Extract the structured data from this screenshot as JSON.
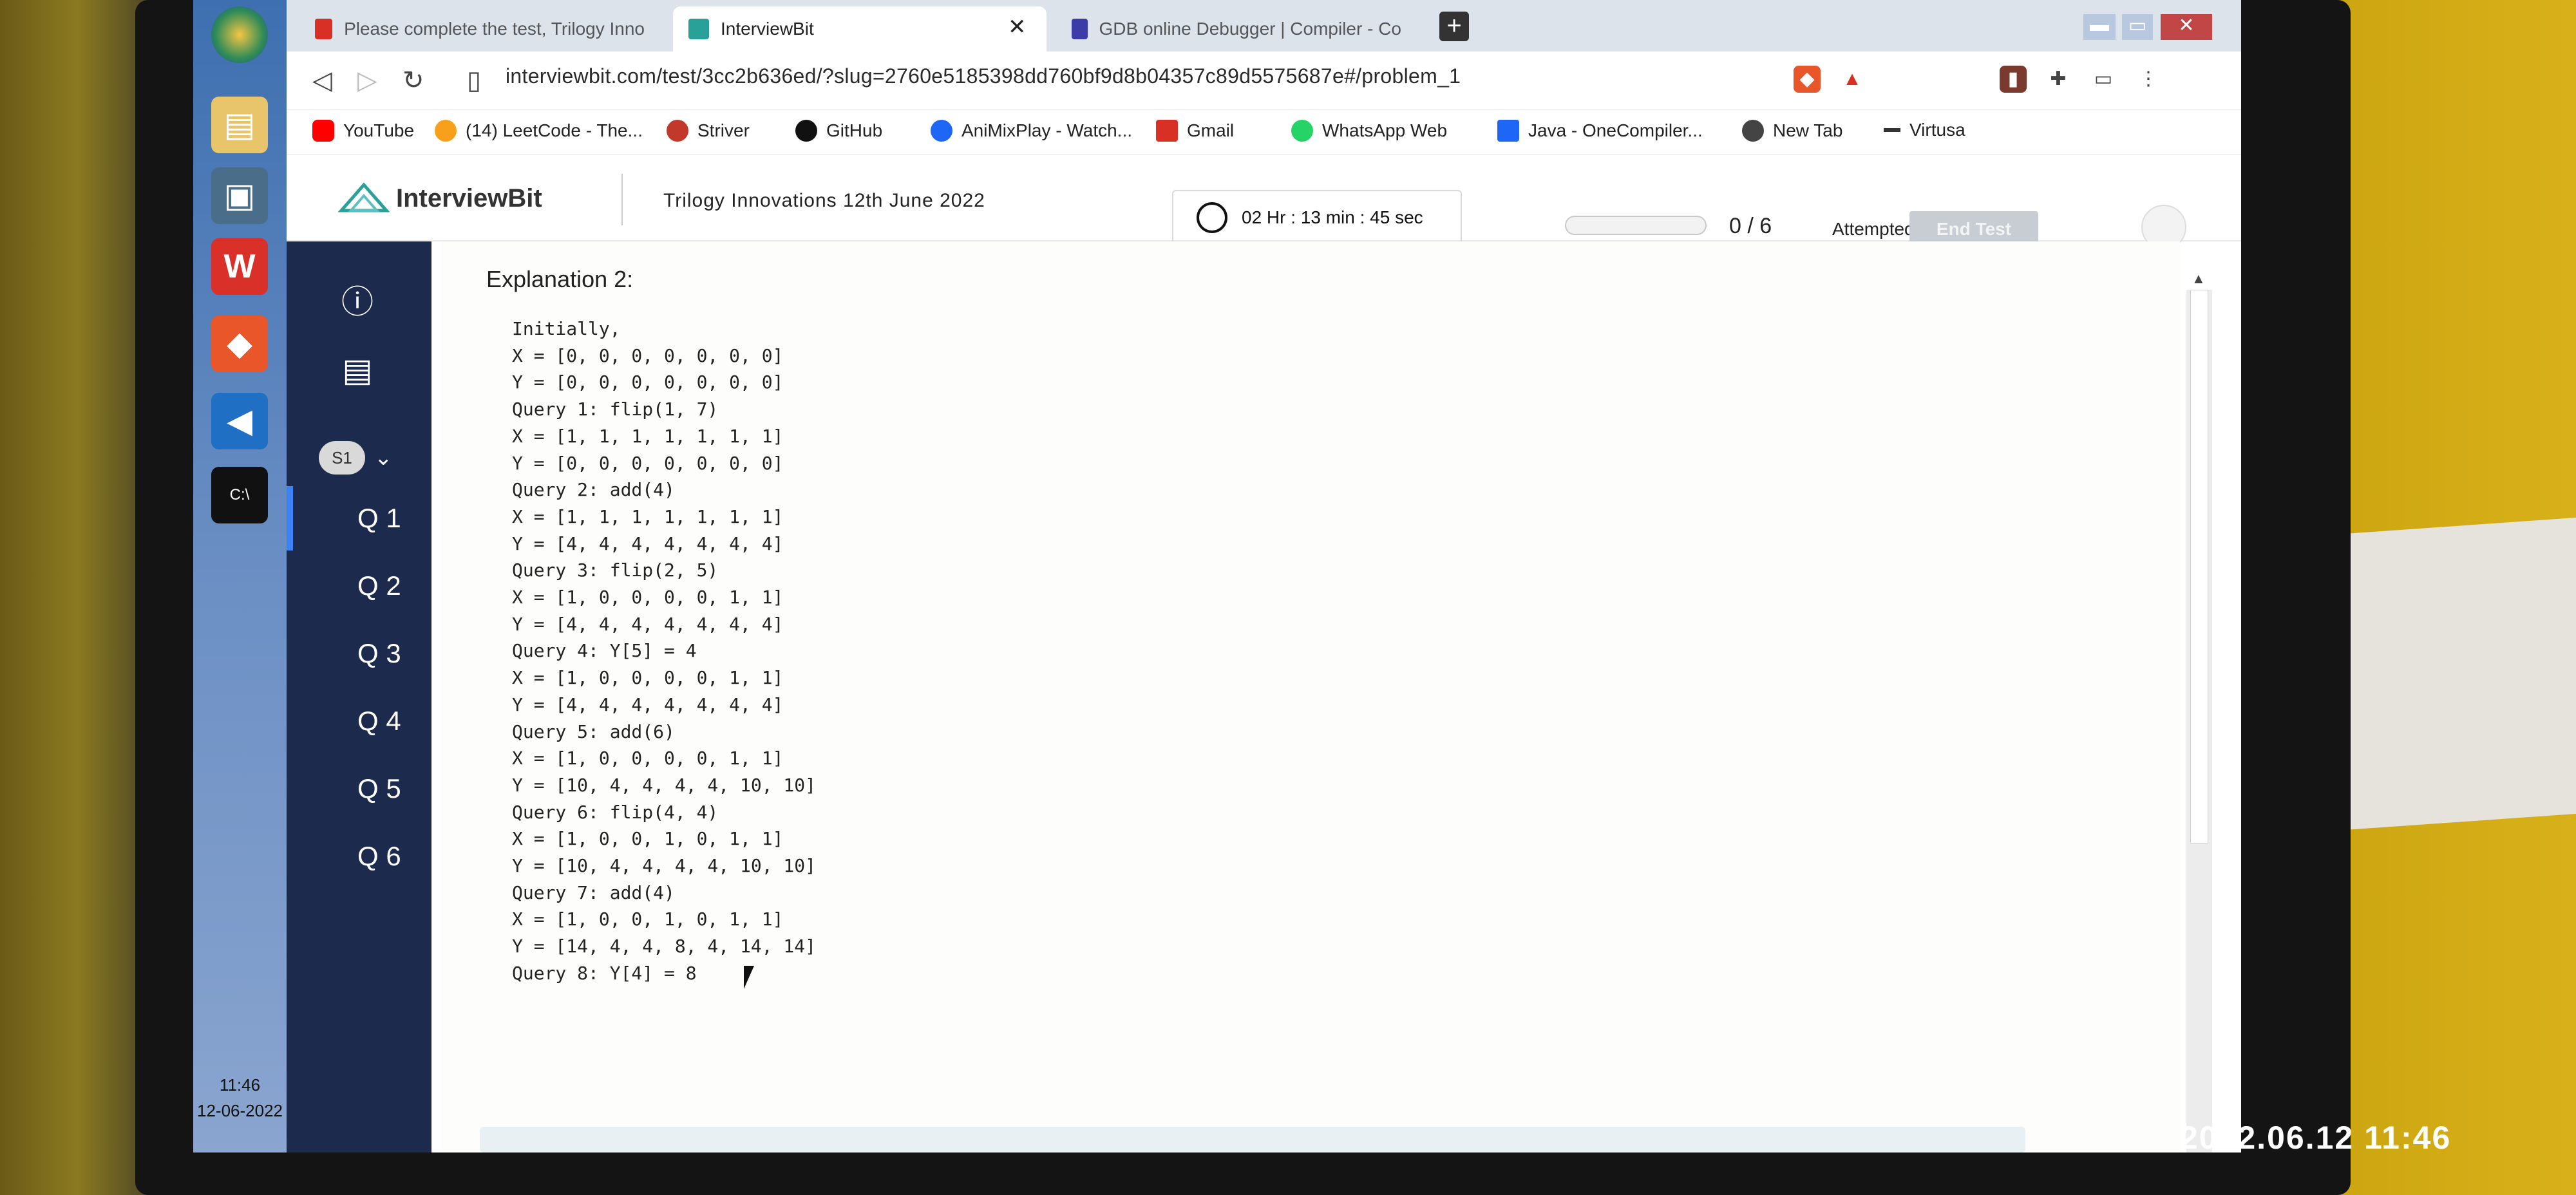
{
  "browser": {
    "tabs": [
      {
        "label": "Please complete the test, Trilogy Inno",
        "favicon_color": "#d93025"
      },
      {
        "label": "InterviewBit",
        "favicon_color": "#2aa198",
        "active": true
      },
      {
        "label": "GDB online Debugger | Compiler - Co",
        "favicon_color": "#3c3ca8"
      }
    ],
    "url": "interviewbit.com/test/3cc2b636ed/?slug=2760e5185398dd760bf9d8b04357c89d5575687e#/problem_1",
    "bookmarks": [
      {
        "label": "YouTube",
        "color": "#ff0000"
      },
      {
        "label": "(14) LeetCode - The...",
        "color": "#f89f1b"
      },
      {
        "label": "Striver",
        "color": "#c0392b"
      },
      {
        "label": "GitHub",
        "color": "#111111"
      },
      {
        "label": "AniMixPlay - Watch...",
        "color": "#1e66f5"
      },
      {
        "label": "Gmail",
        "color": "#d93025"
      },
      {
        "label": "WhatsApp Web",
        "color": "#25d366"
      },
      {
        "label": "Java - OneCompiler...",
        "color": "#1e66f5"
      },
      {
        "label": "New Tab",
        "color": "#444444"
      },
      {
        "label": "Virtusa",
        "color": "#333333"
      }
    ]
  },
  "header": {
    "logo": "InterviewBit",
    "contest": "Trilogy Innovations 12th June 2022",
    "timer": "02 Hr : 13 min : 45 sec",
    "attempted_count": "0 / 6",
    "attempted_label": "Attempted",
    "attempted_fraction": 0,
    "end_test": "End Test"
  },
  "sidebar": {
    "section": "S1",
    "questions": [
      "Q 1",
      "Q 2",
      "Q 3",
      "Q 4",
      "Q 5",
      "Q 6"
    ],
    "active": "Q 1"
  },
  "content": {
    "title": "Explanation 2:",
    "lines": [
      "Initially,",
      "X = [0, 0, 0, 0, 0, 0, 0]",
      "Y = [0, 0, 0, 0, 0, 0, 0]",
      "Query 1: flip(1, 7)",
      "X = [1, 1, 1, 1, 1, 1, 1]",
      "Y = [0, 0, 0, 0, 0, 0, 0]",
      "Query 2: add(4)",
      "X = [1, 1, 1, 1, 1, 1, 1]",
      "Y = [4, 4, 4, 4, 4, 4, 4]",
      "Query 3: flip(2, 5)",
      "X = [1, 0, 0, 0, 0, 1, 1]",
      "Y = [4, 4, 4, 4, 4, 4, 4]",
      "Query 4: Y[5] = 4",
      "X = [1, 0, 0, 0, 0, 1, 1]",
      "Y = [4, 4, 4, 4, 4, 4, 4]",
      "Query 5: add(6)",
      "X = [1, 0, 0, 0, 0, 1, 1]",
      "Y = [10, 4, 4, 4, 4, 10, 10]",
      "Query 6: flip(4, 4)",
      "X = [1, 0, 0, 1, 0, 1, 1]",
      "Y = [10, 4, 4, 4, 4, 10, 10]",
      "Query 7: add(4)",
      "X = [1, 0, 0, 1, 0, 1, 1]",
      "Y = [14, 4, 4, 8, 4, 14, 14]",
      "Query 8: Y[4] = 8"
    ]
  },
  "taskbar": {
    "time": "11:46",
    "date": "12-06-2022"
  },
  "photo_stamp": "2022.06.12 11:46"
}
